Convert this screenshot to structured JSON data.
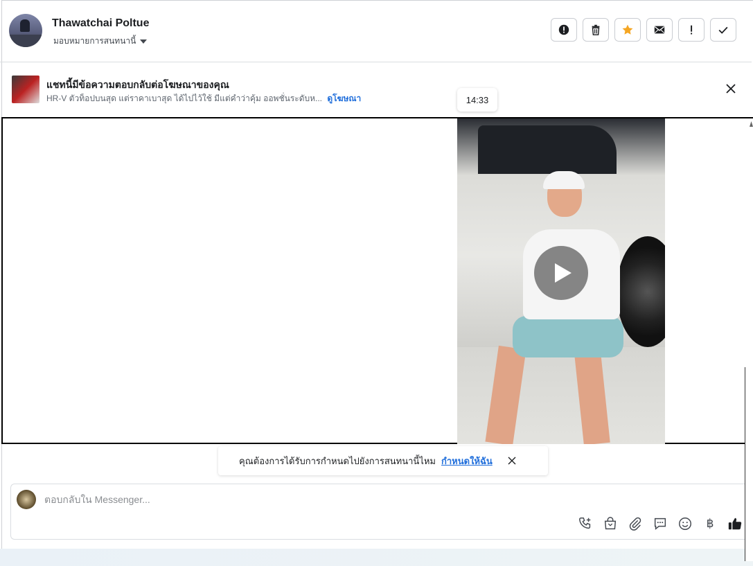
{
  "header": {
    "user_name": "Thawatchai Poltue",
    "assign_label": "มอบหมายการสนทนานี้",
    "actions": [
      {
        "name": "report-icon",
        "label": "report"
      },
      {
        "name": "trash-icon",
        "label": "delete"
      },
      {
        "name": "star-icon",
        "label": "star"
      },
      {
        "name": "mail-icon",
        "label": "mark unread"
      },
      {
        "name": "exclamation-icon",
        "label": "important"
      },
      {
        "name": "check-icon",
        "label": "done"
      }
    ],
    "star_color": "#f5a623"
  },
  "ad_banner": {
    "title": "แชทนี้มีข้อความตอบกลับต่อโฆษณาของคุณ",
    "description": "HR-V ตัวท็อปบนสุด แต่ราคาเบาสุด ได้ไปไว้ใช้ มีแต่คำว่าคุ้ม ออพชั่นระดับห...",
    "link_label": "ดูโฆษณา"
  },
  "message": {
    "timestamp": "14:33",
    "type": "video"
  },
  "reminder": {
    "text": "คุณต้องการได้รับการกำหนดไปยังการสนทนานี้ไหม",
    "link_label": "กำหนดให้ฉัน"
  },
  "composer": {
    "placeholder": "ตอบกลับใน Messenger...",
    "currency_symbol": "฿",
    "accent_color": "#216fdb"
  }
}
